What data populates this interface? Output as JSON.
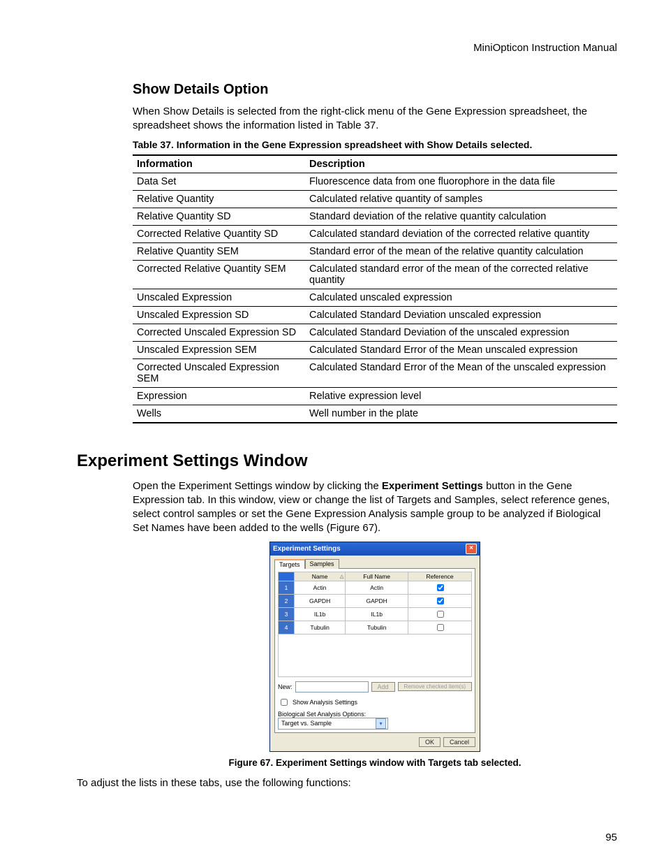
{
  "header": {
    "manual": "MiniOpticon Instruction Manual"
  },
  "section1": {
    "title": "Show Details Option",
    "para": "When Show Details is selected from the right-click menu of the Gene Expression spreadsheet, the spreadsheet shows the information listed in Table 37.",
    "table_caption": "Table 37. Information in the Gene Expression spreadsheet with Show Details selected.",
    "col1": "Information",
    "col2": "Description",
    "rows": [
      {
        "info": "Data Set",
        "desc": "Fluorescence data from one fluorophore in the data file"
      },
      {
        "info": "Relative Quantity",
        "desc": "Calculated relative quantity of samples"
      },
      {
        "info": "Relative Quantity SD",
        "desc": "Standard deviation of the relative quantity calculation"
      },
      {
        "info": "Corrected Relative Quantity SD",
        "desc": "Calculated standard deviation of the corrected relative quantity"
      },
      {
        "info": "Relative Quantity SEM",
        "desc": "Standard error of the mean of the relative quantity calculation"
      },
      {
        "info": "Corrected Relative Quantity SEM",
        "desc": "Calculated standard error of the mean of the corrected relative quantity"
      },
      {
        "info": "Unscaled Expression",
        "desc": "Calculated unscaled expression"
      },
      {
        "info": "Unscaled Expression SD",
        "desc": "Calculated Standard Deviation unscaled expression"
      },
      {
        "info": "Corrected Unscaled Expression SD",
        "desc": "Calculated Standard Deviation of the unscaled expression"
      },
      {
        "info": "Unscaled Expression SEM",
        "desc": "Calculated Standard Error of the Mean unscaled expression"
      },
      {
        "info": "Corrected Unscaled Expression SEM",
        "desc": "Calculated Standard Error of the Mean of the unscaled expression"
      },
      {
        "info": "Expression",
        "desc": "Relative expression level"
      },
      {
        "info": "Wells",
        "desc": "Well number in the plate"
      }
    ]
  },
  "section2": {
    "title": "Experiment Settings Window",
    "para_pre": "Open the Experiment Settings window by clicking the ",
    "para_bold": "Experiment Settings",
    "para_post": " button in the Gene Expression tab. In this window, view or change the list of Targets and Samples, select reference genes, select control samples or set the Gene Expression Analysis sample group to be analyzed if Biological Set Names have been added to the wells (Figure 67).",
    "figure_caption": "Figure 67. Experiment Settings window with Targets tab selected.",
    "para2": "To adjust the lists in these tabs, use the following functions:"
  },
  "es": {
    "title": "Experiment Settings",
    "tabs": {
      "targets": "Targets",
      "samples": "Samples"
    },
    "headers": {
      "name": "Name",
      "fullname": "Full Name",
      "reference": "Reference"
    },
    "rows": [
      {
        "n": "1",
        "name": "Actin",
        "full": "Actin",
        "ref": true
      },
      {
        "n": "2",
        "name": "GAPDH",
        "full": "GAPDH",
        "ref": true
      },
      {
        "n": "3",
        "name": "IL1b",
        "full": "IL1b",
        "ref": false
      },
      {
        "n": "4",
        "name": "Tubulin",
        "full": "Tubulin",
        "ref": false
      }
    ],
    "new_label": "New:",
    "add": "Add",
    "remove": "Remove checked item(s)",
    "show_analysis": "Show Analysis Settings",
    "bio_label": "Biological Set Analysis Options:",
    "bio_value": "Target vs. Sample",
    "ok": "OK",
    "cancel": "Cancel"
  },
  "page_number": "95"
}
